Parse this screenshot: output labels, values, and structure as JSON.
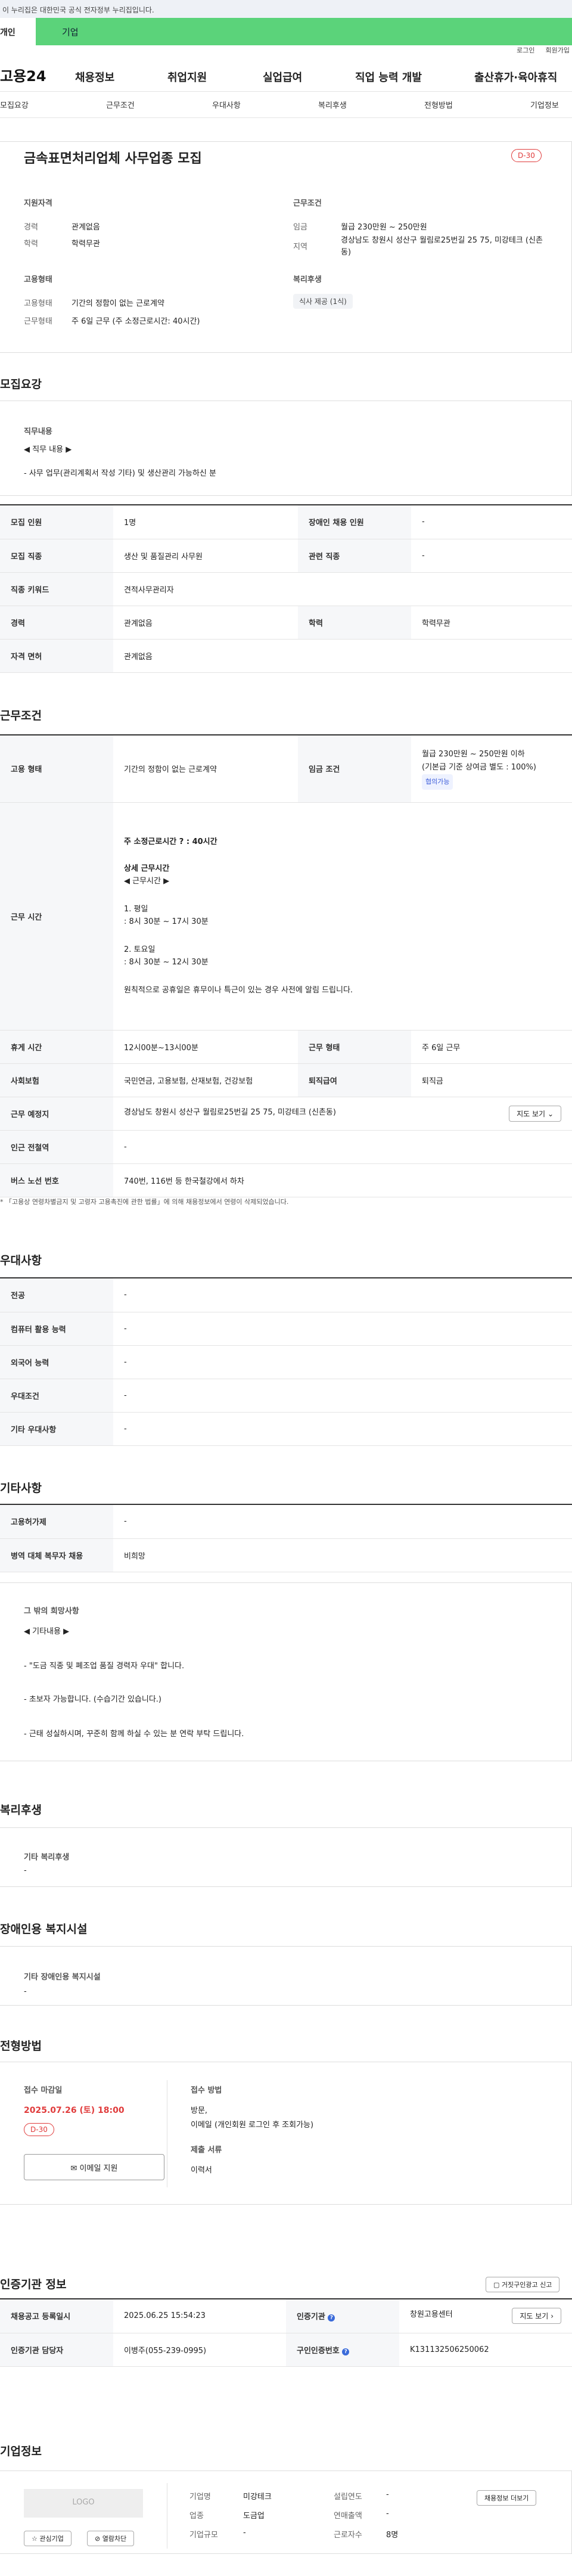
{
  "gov_bar": "이 누리집은 대한민국 공식 전자정부 누리집입니다.",
  "tabs": {
    "individual": "개인",
    "business": "기업"
  },
  "util": {
    "login": "로그인",
    "join": "회원가입"
  },
  "logo": "고용24",
  "gnb": [
    "채용정보",
    "취업지원",
    "실업급여",
    "직업 능력 개발",
    "출산휴가·육아휴직"
  ],
  "anchor": [
    "모집요강",
    "근무조건",
    "우대사항",
    "복리후생",
    "전형방법",
    "기업정보"
  ],
  "summary": {
    "title": "금속표면처리업체 사무업종 모집",
    "dday": "D-30",
    "qual_title": "지원자격",
    "career_l": "경력",
    "career_v": "관계없음",
    "edu_l": "학력",
    "edu_v": "학력무관",
    "emp_title": "고용형태",
    "emptype_l": "고용형태",
    "emptype_v": "기간의 정함이 없는 근로계약",
    "worktype_l": "근무형태",
    "worktype_v": "주 6일 근무 (주 소정근로시간: 40시간)",
    "cond_title": "근무조건",
    "wage_l": "임금",
    "wage_v": "월급 230만원 ~ 250만원",
    "loc_l": "지역",
    "loc_v": "경상남도 창원시 성산구 월림로25번길 25 75, 미강테크 (신촌동)",
    "welfare_title": "복리후생",
    "welfare_tag": "식사 제공 (1식)"
  },
  "recruit": {
    "section": "모집요강",
    "duty_title": "직무내용",
    "duty_sub": "◀ 직무 내용 ▶",
    "duty_text": "- 사무 업무(관리계획서 작성 기타) 및 생산관리 가능하신 분",
    "rows": [
      {
        "k1": "모집 인원",
        "v1": "1명",
        "k2": "장애인 채용 인원",
        "v2": "-"
      },
      {
        "k1": "모집 직종",
        "v1": "생산 및 품질관리 사무원",
        "k2": "관련 직종",
        "v2": "-"
      },
      {
        "k1": "직종 키워드",
        "v1": "견적사무관리자"
      },
      {
        "k1": "경력",
        "v1": "관계없음",
        "k2": "학력",
        "v2": "학력무관"
      },
      {
        "k1": "자격 면허",
        "v1": "관계없음"
      }
    ]
  },
  "work": {
    "section": "근무조건",
    "emp_l": "고용 형태",
    "emp_v": "기간의 정함이 없는 근로계약",
    "wage_l": "임금 조건",
    "wage_v1": "월급 230만원 ~ 250만원 이하",
    "wage_v2": "(기본급 기준 상여금 별도 : 100%)",
    "wage_badge": "협의가능",
    "time_l": "근무 시간",
    "time_1": "주 소정근로시간 ? : 40시간",
    "time_2": "상세 근무시간",
    "time_3": "◀ 근무시간 ▶",
    "time_4": "1. 평일",
    "time_5": ": 8시 30분 ~ 17시 30분",
    "time_6": "2. 토요일",
    "time_7": ": 8시 30분 ~ 12시 30분",
    "time_8": "원칙적으로 공휴일은 휴무이나 특근이 있는 경우 사전에 알림 드립니다.",
    "rest_l": "휴게 시간",
    "rest_v": "12시00분~13시00분",
    "form_l": "근무 형태",
    "form_v": "주 6일 근무",
    "ins_l": "사회보험",
    "ins_v": "국민연금, 고용보험, 산재보험, 건강보험",
    "sev_l": "퇴직급여",
    "sev_v": "퇴직금",
    "place_l": "근무 예정지",
    "place_v": "경상남도 창원시 성산구 월림로25번길 25 75, 미강테크 (신촌동)",
    "map_btn": "지도 보기",
    "station_l": "인근 전철역",
    "station_v": "-",
    "bus_l": "버스 노선 번호",
    "bus_v": "740번, 116번 등 한국철강에서 하차",
    "note": "* 「고용상 연령차별금지 및 고령자 고용촉진에 관한 법률」에 의해 채용정보에서 연령이 삭제되었습니다."
  },
  "pref": {
    "section": "우대사항",
    "rows": [
      {
        "k": "전공",
        "v": "-"
      },
      {
        "k": "컴퓨터 활용 능력",
        "v": "-"
      },
      {
        "k": "외국어 능력",
        "v": "-"
      },
      {
        "k": "우대조건",
        "v": "-"
      },
      {
        "k": "기타 우대사항",
        "v": "-"
      }
    ]
  },
  "etc": {
    "section": "기타사항",
    "rows": [
      {
        "k": "고용허가제",
        "v": "-"
      },
      {
        "k": "병역 대체 복무자 채용",
        "v": "비희망"
      }
    ],
    "box_title": "그 밖의 희망사항",
    "box_sub": "◀ 기타내용 ▶",
    "box_1": "- \"도금 직종 및 폐조업 품질 경력자 우대\" 합니다.",
    "box_2": "- 초보자 가능합니다. (수습기간 있습니다.)",
    "box_3": "- 근태 성실하시며, 꾸준히 함께 하실 수 있는 분 연락 부탁 드립니다."
  },
  "welfare": {
    "section": "복리후생",
    "title": "기타 복리후생",
    "value": "-"
  },
  "disabled": {
    "section": "장애인용 복지시설",
    "title": "기타 장애인용 복지시설",
    "value": "-"
  },
  "process": {
    "section": "전형방법",
    "deadline_l": "접수 마감일",
    "deadline_v": "2025.07.26 (토) 18:00",
    "dday": "D-30",
    "email_btn": "이메일 지원",
    "method_l": "접수 방법",
    "method_v1": "방문,",
    "method_v2": "이메일 (개인회원 로그인 후 조회가능)",
    "docs_l": "제출 서류",
    "docs_v": "이력서"
  },
  "agency": {
    "section": "인증기관 정보",
    "report_btn": "거짓구인광고 신고",
    "reg_l": "채용공고 등록일시",
    "reg_v": "2025.06.25 15:54:23",
    "org_l": "인증기관",
    "org_v": "창원고용센터",
    "map_btn": "지도 보기",
    "mgr_l": "인증기관 담당자",
    "mgr_v": "이병주(055-239-0995)",
    "no_l": "구인인증번호",
    "no_v": "K131132506250062"
  },
  "company": {
    "section": "기업정보",
    "logo": "LOGO",
    "fav_btn": "관심기업",
    "block_btn": "열람차단",
    "name_l": "기업명",
    "name_v": "미강테크",
    "ind_l": "업종",
    "ind_v": "도금업",
    "size_l": "기업규모",
    "size_v": "-",
    "year_l": "설립연도",
    "year_v": "-",
    "sales_l": "연매출액",
    "sales_v": "-",
    "emp_l": "근로자수",
    "emp_v": "8명",
    "more_btn": "채용정보 더보기"
  }
}
